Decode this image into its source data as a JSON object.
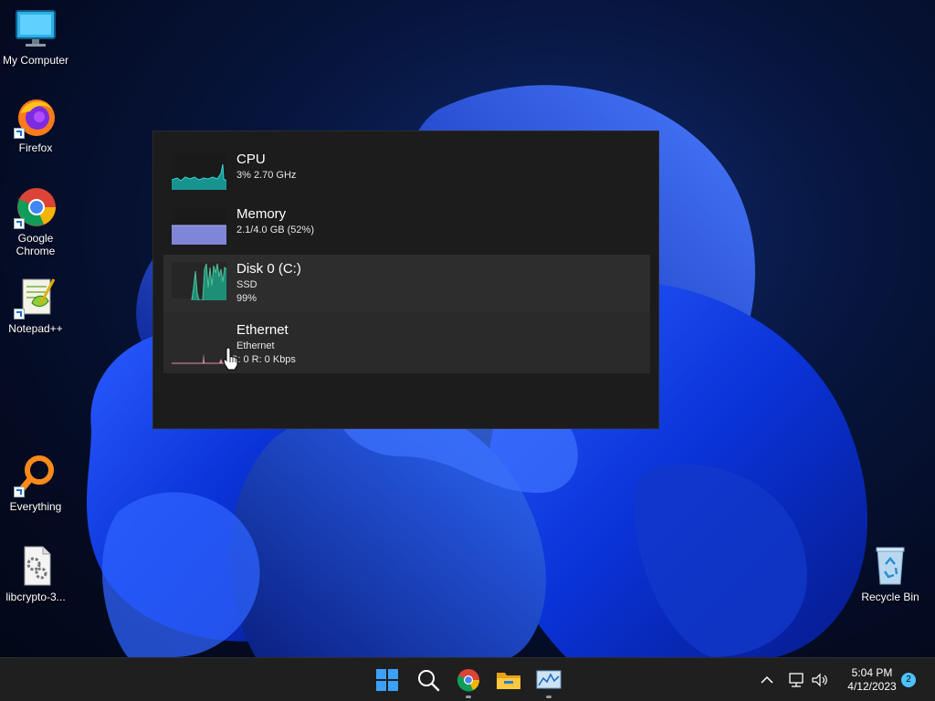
{
  "desktop_icons": [
    {
      "label": "My Computer"
    },
    {
      "label": "Firefox"
    },
    {
      "label": "Google Chrome"
    },
    {
      "label": "Notepad++"
    },
    {
      "label": "Everything"
    },
    {
      "label": "libcrypto-3..."
    },
    {
      "label": "Recycle Bin"
    }
  ],
  "performance": {
    "items": [
      {
        "title": "CPU",
        "lines": [
          "3% 2.70 GHz"
        ],
        "color": "#17a9a6"
      },
      {
        "title": "Memory",
        "lines": [
          "2.1/4.0 GB (52%)"
        ],
        "color": "#7f86d8",
        "usage_fraction": 0.52
      },
      {
        "title": "Disk 0 (C:)",
        "lines": [
          "SSD",
          "99%"
        ],
        "color": "#4fc29a"
      },
      {
        "title": "Ethernet",
        "lines": [
          "Ethernet",
          "S: 0 R: 0 Kbps"
        ],
        "color": "#e48fb3"
      }
    ]
  },
  "taskbar": {
    "apps": [
      "start-icon",
      "search-icon",
      "chrome-icon",
      "file-explorer-icon",
      "task-manager-icon"
    ],
    "time": "5:04 PM",
    "date": "4/12/2023",
    "notification_count": "2"
  },
  "colors": {
    "accent": "#1a56ff",
    "panel_bg": "#1c1c1c",
    "taskbar_bg": "#1f1f1f"
  }
}
